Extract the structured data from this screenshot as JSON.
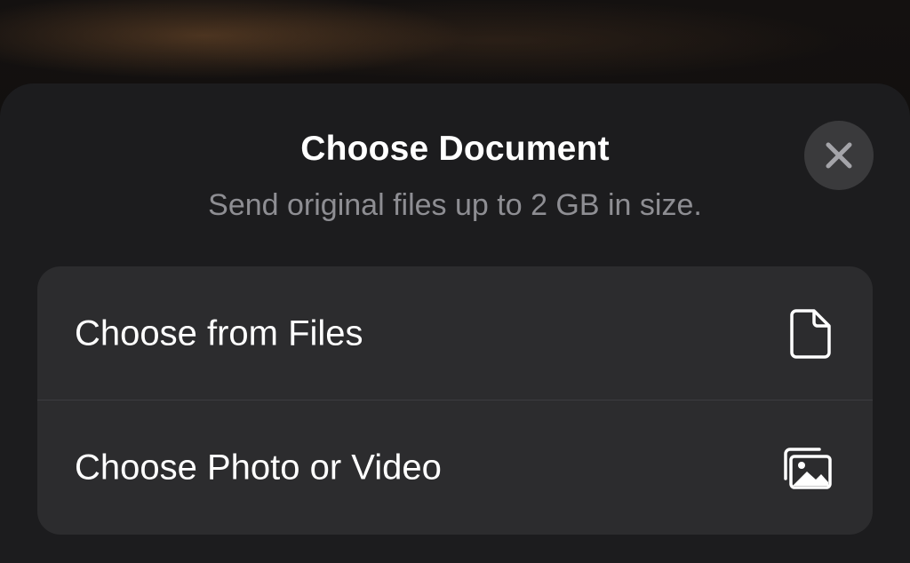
{
  "sheet": {
    "title": "Choose Document",
    "subtitle": "Send original files up to 2 GB in size."
  },
  "close_button": {
    "icon": "close-icon"
  },
  "options": [
    {
      "label": "Choose from Files",
      "icon": "document-icon"
    },
    {
      "label": "Choose Photo or Video",
      "icon": "photo-library-icon"
    }
  ],
  "colors": {
    "sheet_background": "#1c1c1e",
    "group_background": "#2c2c2e",
    "close_button_background": "#3a3a3c",
    "title_text": "#ffffff",
    "subtitle_text": "#8e8e93"
  }
}
